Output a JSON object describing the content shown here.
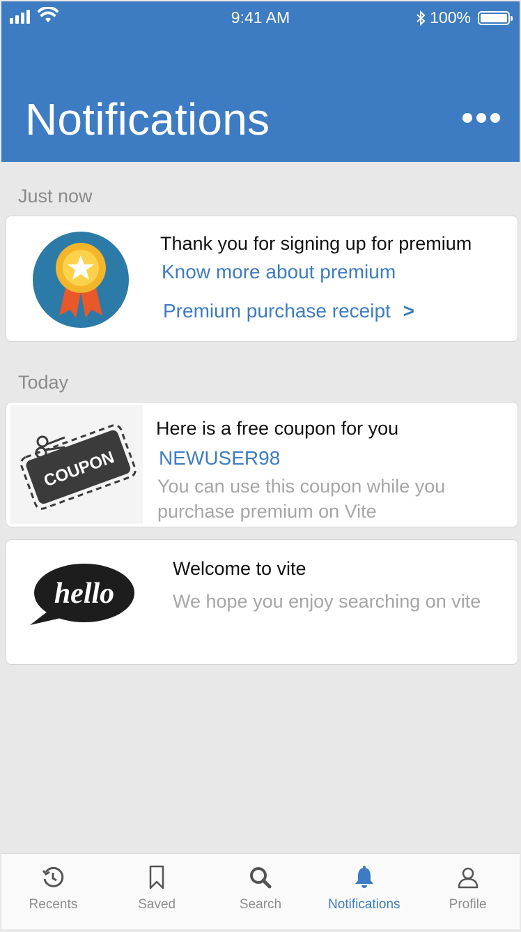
{
  "status_bar": {
    "time": "9:41 AM",
    "battery": "100%"
  },
  "header": {
    "title": "Notifications"
  },
  "sections": [
    {
      "label": "Just now"
    },
    {
      "label": "Today"
    }
  ],
  "notifications": [
    {
      "title": "Thank you for signing up for premium",
      "link1": "Know more about premium",
      "link2": "Premium purchase receipt",
      "link2_arrow": ">"
    },
    {
      "title": "Here is a free coupon for you",
      "code": "NEWUSER98",
      "description": "You can use this coupon while you purchase premium on Vite",
      "image_text": "COUPON"
    },
    {
      "title": "Welcome to vite",
      "description": "We hope you enjoy searching on vite",
      "image_text": "hello"
    }
  ],
  "tabs": [
    {
      "label": "Recents",
      "icon": "history-icon"
    },
    {
      "label": "Saved",
      "icon": "bookmark-icon"
    },
    {
      "label": "Search",
      "icon": "search-icon"
    },
    {
      "label": "Notifications",
      "icon": "bell-icon",
      "active": true
    },
    {
      "label": "Profile",
      "icon": "profile-icon"
    }
  ],
  "colors": {
    "accent": "#3d7cc2",
    "background": "#e8e8e8",
    "muted_text": "#a6a6a6"
  }
}
